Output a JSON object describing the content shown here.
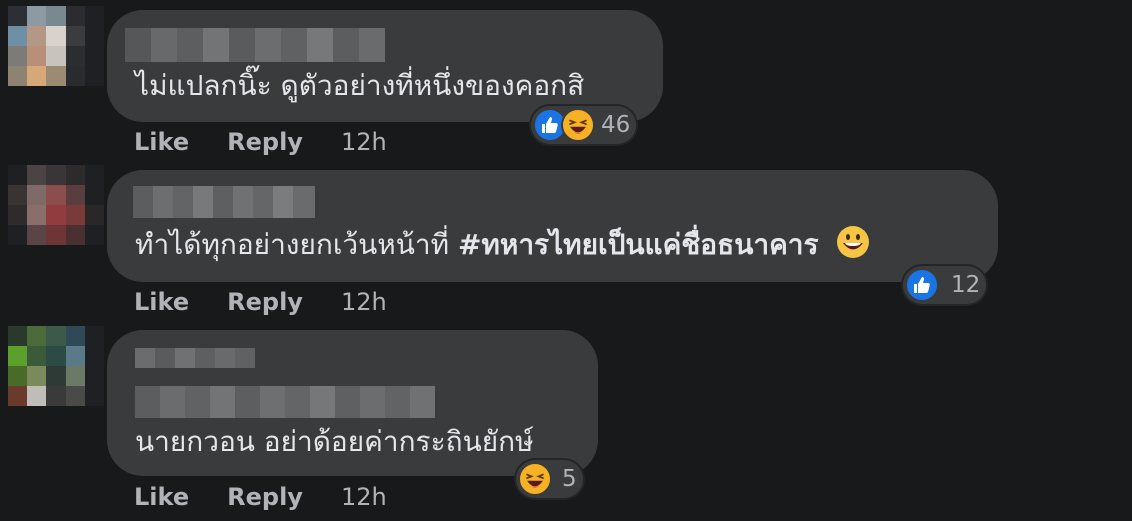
{
  "colors": {
    "background": "#18191a",
    "bubble": "#3a3b3c",
    "text": "#e4e6eb",
    "secondary_text": "#b0b3b8",
    "like_blue": "#1b74e4",
    "haha_yellow": "#f7b125"
  },
  "comments": [
    {
      "text": "ไม่แปลกนิ๊ะ ดูตัวอย่างที่หนึ่งของคอกสิ",
      "reactions": [
        "like",
        "haha"
      ],
      "reaction_count": "46",
      "actions": {
        "like": "Like",
        "reply": "Reply",
        "time": "12h"
      }
    },
    {
      "text": "ทำได้ทุกอย่างยกเว้นหน้าที่",
      "hashtag": "#ทหารไทยเป็นแค่ชื่อธนาคาร",
      "inline_emoji": "grinning-face",
      "reactions": [
        "like"
      ],
      "reaction_count": "12",
      "actions": {
        "like": "Like",
        "reply": "Reply",
        "time": "12h"
      }
    },
    {
      "text": "นายกวอน อย่าด้อยค่ากระถินยักษ์",
      "reactions": [
        "haha"
      ],
      "reaction_count": "5",
      "actions": {
        "like": "Like",
        "reply": "Reply",
        "time": "12h"
      }
    }
  ]
}
